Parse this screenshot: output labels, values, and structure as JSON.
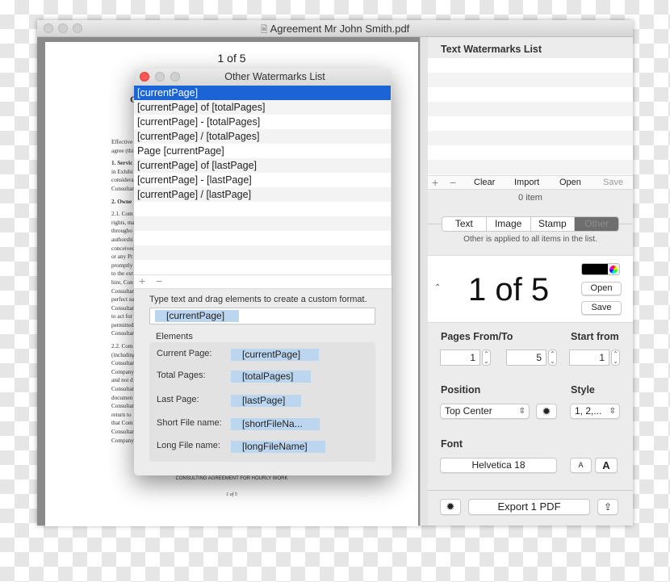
{
  "window": {
    "title": "Agreement Mr John Smith.pdf",
    "file_icon": "pdf-file-icon"
  },
  "document": {
    "page_header": "1 of 5",
    "heading_fragment": "C",
    "lines": [
      "Effective",
      "agree (thi",
      "1. Servic",
      "in Exhibi",
      "considera",
      "Consultan",
      "2. Owne",
      "2.1. Com",
      "rights, ma",
      "througho",
      "authorshi",
      "conceived",
      "or any Pr",
      "promptly",
      "to the ext",
      "hire, Con",
      "Consultan",
      "perfect su",
      "Consultan",
      "to act for",
      "permitted",
      "Consultan",
      "2.2. Com",
      "(including",
      "Consultan",
      "Company",
      "and not d",
      "Consultan",
      "documen",
      "Consultan",
      "return to",
      "that Com",
      "Consultan",
      "Company"
    ],
    "footer": "CONSULTING AGREEMENT FOR HOURLY WORK",
    "footer_page": "1 of 5"
  },
  "dialog": {
    "title": "Other Watermarks List",
    "items": [
      "[currentPage]",
      "[currentPage] of [totalPages]",
      "[currentPage] - [totalPages]",
      "[currentPage] / [totalPages]",
      "Page [currentPage]",
      "[currentPage] of [lastPage]",
      "[currentPage] - [lastPage]",
      "[currentPage] / [lastPage]"
    ],
    "selected_index": 0,
    "add": "+",
    "remove": "−",
    "instruction": "Type text and drag elements to create a custom format.",
    "format_value": "[currentPage]",
    "elements_label": "Elements",
    "elements": [
      {
        "label": "Current Page:",
        "token": "[currentPage]"
      },
      {
        "label": "Total Pages:",
        "token": "[totalPages]"
      },
      {
        "label": "Last Page:",
        "token": "[lastPage]"
      },
      {
        "label": "Short File name:",
        "token": "[shortFileNa..."
      },
      {
        "label": "Long File name:",
        "token": "[longFileName]"
      }
    ]
  },
  "panel": {
    "title": "Text Watermarks List",
    "toolbar": {
      "add": "+",
      "remove": "−",
      "clear": "Clear",
      "import": "Import",
      "open": "Open",
      "save": "Save"
    },
    "count": "0 item",
    "tabs": [
      "Text",
      "Image",
      "Stamp",
      "Other"
    ],
    "active_tab": "Other",
    "tab_hint": "Other is applied to all items in the list.",
    "preview": "1 of 5",
    "color": "#000000",
    "open": "Open",
    "save": "Save",
    "pages_label": "Pages From/To",
    "from": "1",
    "to": "5",
    "start_label": "Start from",
    "start": "1",
    "position_label": "Position",
    "position": "Top Center",
    "style_label": "Style",
    "style": "1, 2,...",
    "font_label": "Font",
    "font": "Helvetica 18",
    "font_smaller": "A",
    "font_larger": "A",
    "export": "Export 1 PDF"
  },
  "colors": {
    "selection": "#1b64d5",
    "token": "#bcd6ef",
    "close": "#fc5753"
  }
}
